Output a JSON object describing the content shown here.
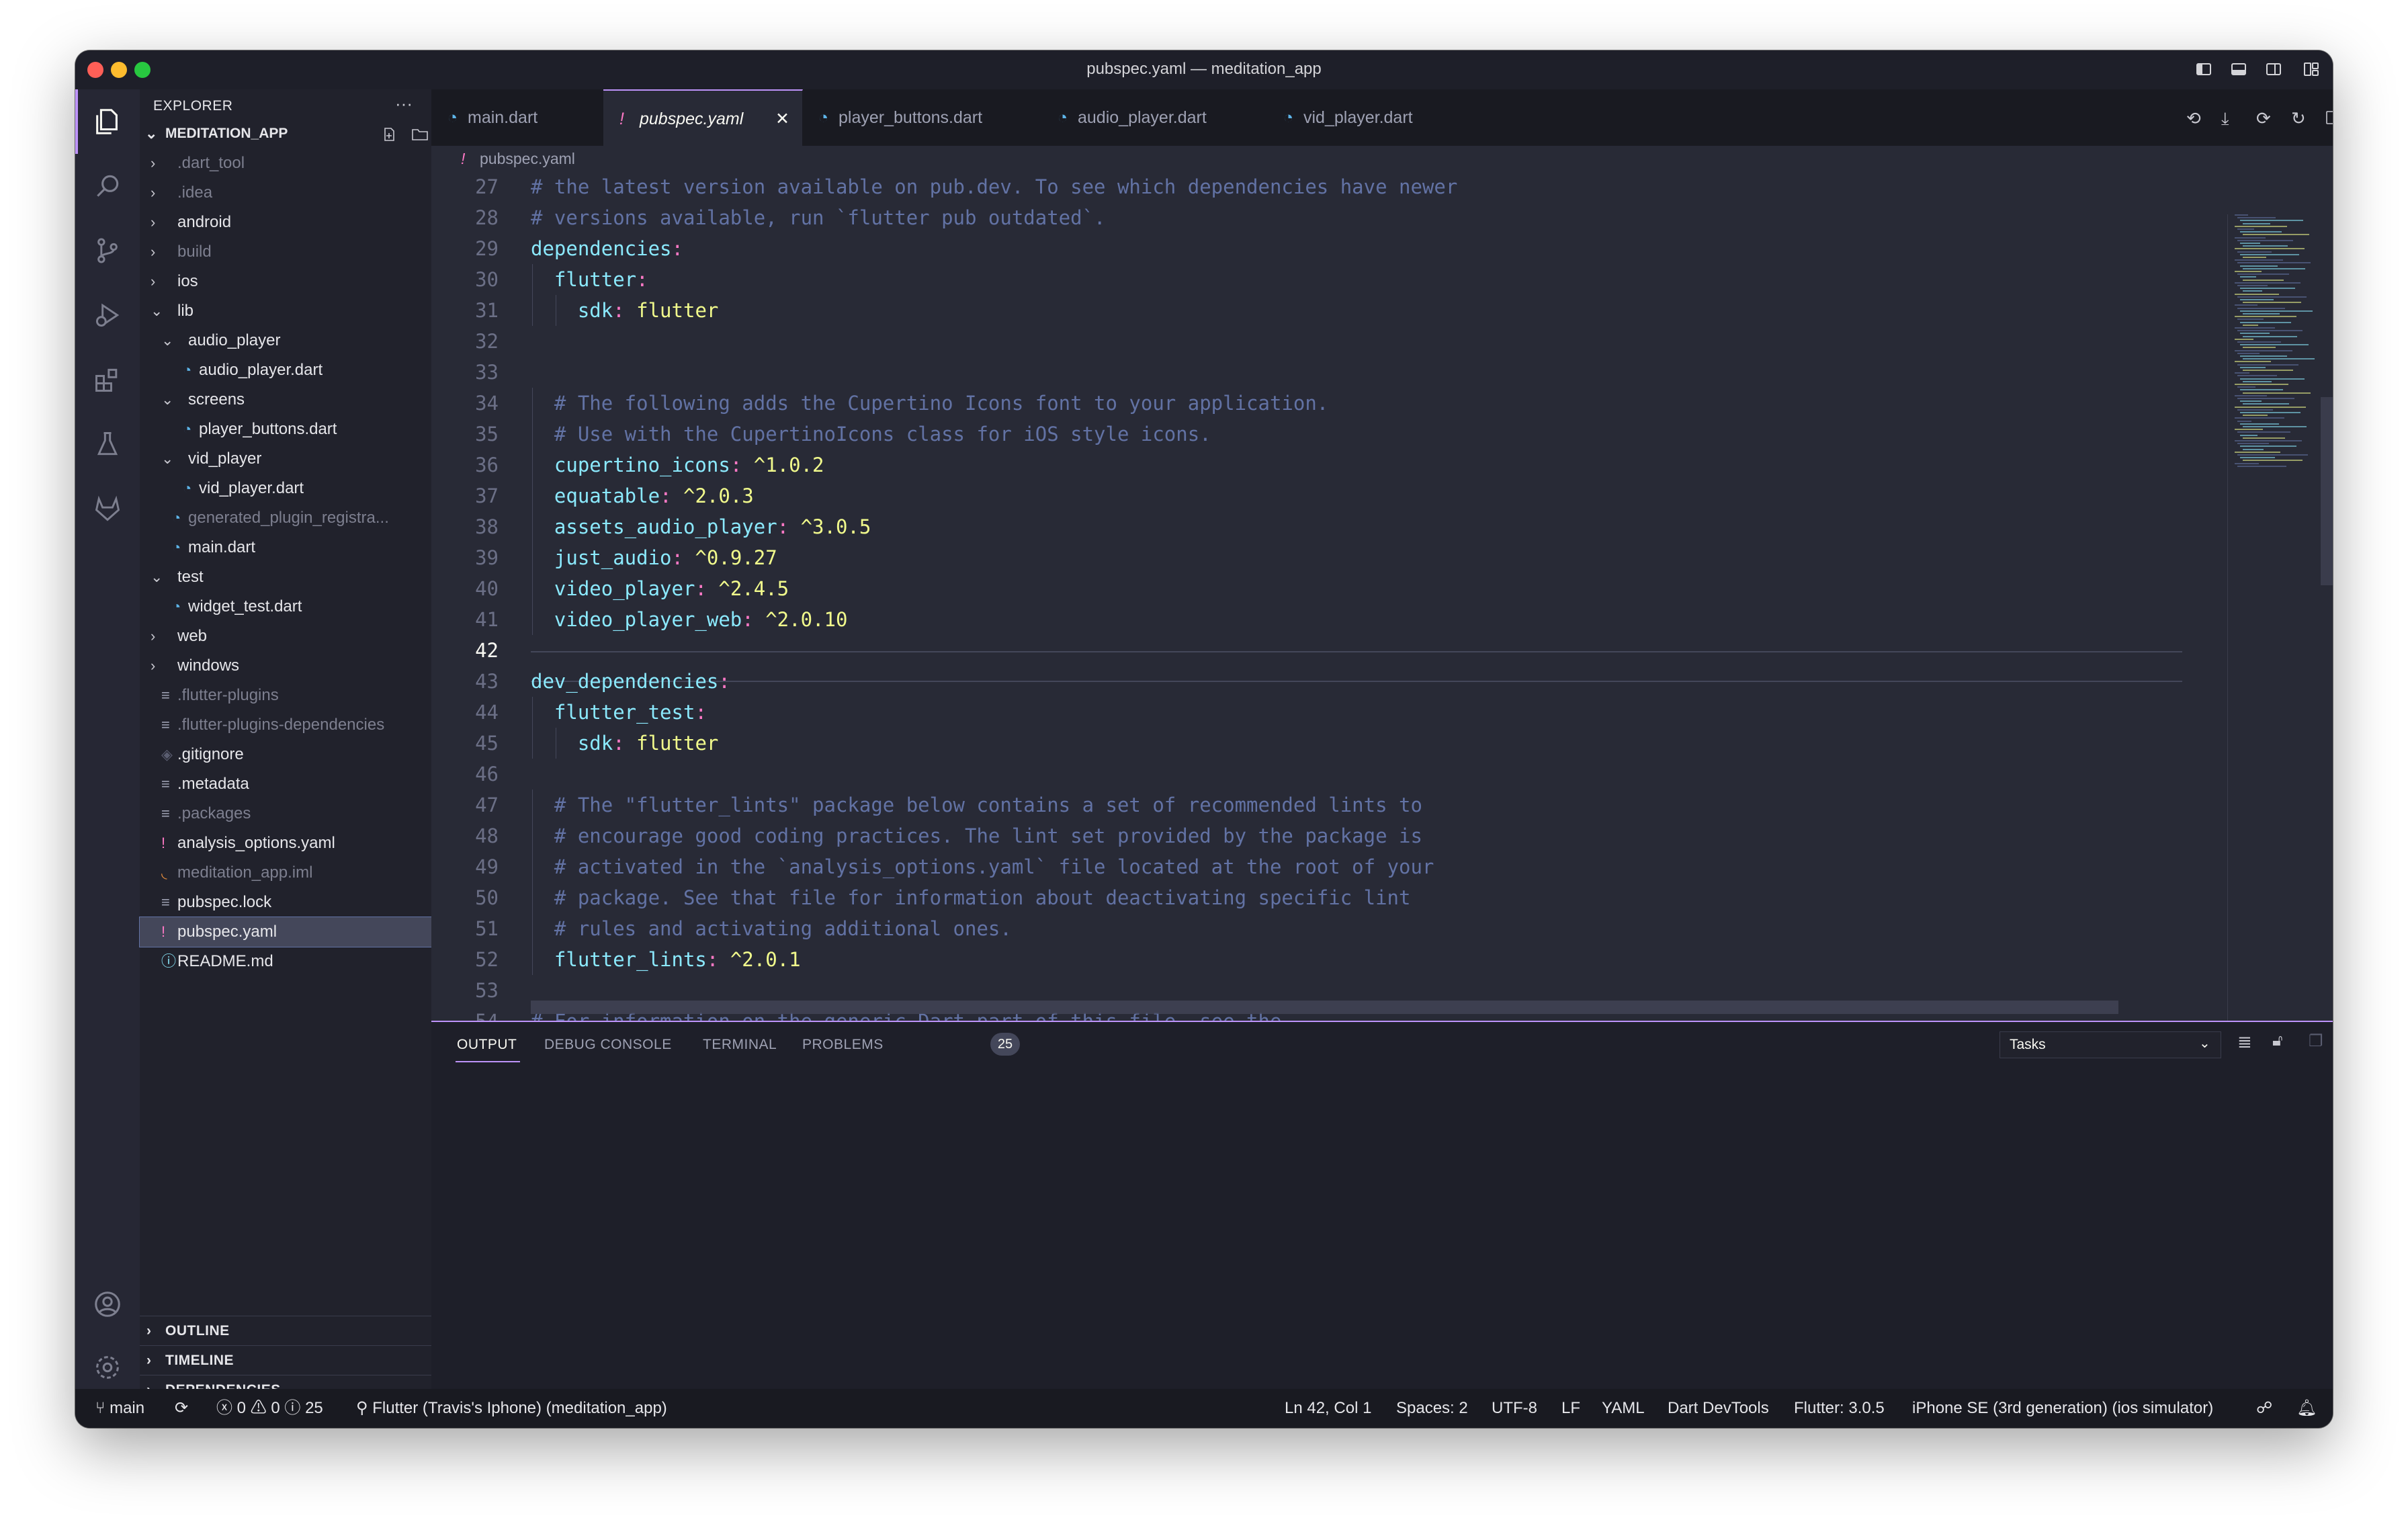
{
  "window": {
    "title": "pubspec.yaml — meditation_app"
  },
  "explorer": {
    "header": "EXPLORER",
    "root": "MEDITATION_APP",
    "items": [
      {
        "label": ".dart_tool",
        "depth": 0,
        "kind": "folder",
        "state": "collapsed",
        "dim": true
      },
      {
        "label": ".idea",
        "depth": 0,
        "kind": "folder",
        "state": "collapsed",
        "dim": true
      },
      {
        "label": "android",
        "depth": 0,
        "kind": "folder",
        "state": "collapsed",
        "dim": false
      },
      {
        "label": "build",
        "depth": 0,
        "kind": "folder",
        "state": "collapsed",
        "dim": true
      },
      {
        "label": "ios",
        "depth": 0,
        "kind": "folder",
        "state": "collapsed",
        "dim": false
      },
      {
        "label": "lib",
        "depth": 0,
        "kind": "folder",
        "state": "expanded",
        "dim": false
      },
      {
        "label": "audio_player",
        "depth": 1,
        "kind": "folder",
        "state": "expanded",
        "dim": false
      },
      {
        "label": "audio_player.dart",
        "depth": 2,
        "kind": "dart",
        "dim": false
      },
      {
        "label": "screens",
        "depth": 1,
        "kind": "folder",
        "state": "expanded",
        "dim": false
      },
      {
        "label": "player_buttons.dart",
        "depth": 2,
        "kind": "dart",
        "dim": false
      },
      {
        "label": "vid_player",
        "depth": 1,
        "kind": "folder",
        "state": "expanded",
        "dim": false
      },
      {
        "label": "vid_player.dart",
        "depth": 2,
        "kind": "dart",
        "dim": false
      },
      {
        "label": "generated_plugin_registra...",
        "depth": 1,
        "kind": "dart",
        "dim": true
      },
      {
        "label": "main.dart",
        "depth": 1,
        "kind": "dart",
        "dim": false
      },
      {
        "label": "test",
        "depth": 0,
        "kind": "folder",
        "state": "expanded",
        "dim": false
      },
      {
        "label": "widget_test.dart",
        "depth": 1,
        "kind": "dart",
        "dim": false
      },
      {
        "label": "web",
        "depth": 0,
        "kind": "folder",
        "state": "collapsed",
        "dim": false
      },
      {
        "label": "windows",
        "depth": 0,
        "kind": "folder",
        "state": "collapsed",
        "dim": false
      },
      {
        "label": ".flutter-plugins",
        "depth": 0,
        "kind": "lines",
        "dim": true
      },
      {
        "label": ".flutter-plugins-dependencies",
        "depth": 0,
        "kind": "lines",
        "dim": true
      },
      {
        "label": ".gitignore",
        "depth": 0,
        "kind": "git",
        "dim": false
      },
      {
        "label": ".metadata",
        "depth": 0,
        "kind": "lines",
        "dim": false
      },
      {
        "label": ".packages",
        "depth": 0,
        "kind": "lines",
        "dim": true
      },
      {
        "label": "analysis_options.yaml",
        "depth": 0,
        "kind": "yaml",
        "dim": false
      },
      {
        "label": "meditation_app.iml",
        "depth": 0,
        "kind": "rss",
        "dim": true
      },
      {
        "label": "pubspec.lock",
        "depth": 0,
        "kind": "lines",
        "dim": false
      },
      {
        "label": "pubspec.yaml",
        "depth": 0,
        "kind": "yaml",
        "dim": false,
        "selected": true
      },
      {
        "label": "README.md",
        "depth": 0,
        "kind": "info",
        "dim": false
      }
    ],
    "sections": [
      "OUTLINE",
      "TIMELINE",
      "DEPENDENCIES"
    ]
  },
  "tabs": [
    {
      "label": "main.dart",
      "icon": "dart-icon",
      "active": false
    },
    {
      "label": "pubspec.yaml",
      "icon": "yaml-icon",
      "active": true
    },
    {
      "label": "player_buttons.dart",
      "icon": "dart-icon",
      "active": false
    },
    {
      "label": "audio_player.dart",
      "icon": "dart-icon",
      "active": false
    },
    {
      "label": "vid_player.dart",
      "icon": "dart-icon",
      "active": false
    }
  ],
  "breadcrumb": "pubspec.yaml",
  "editor": {
    "current_line": 42,
    "lines": [
      {
        "n": "27",
        "parts": [
          [
            "# the latest version available on pub.dev. To see which dependencies have newer",
            "cmt"
          ]
        ]
      },
      {
        "n": "28",
        "parts": [
          [
            "# versions available, run `flutter pub outdated`.",
            "cmt"
          ]
        ]
      },
      {
        "n": "29",
        "parts": [
          [
            "dependencies",
            "key"
          ],
          [
            ":",
            "pun"
          ]
        ]
      },
      {
        "n": "30",
        "parts": [
          [
            "  flutter",
            "key"
          ],
          [
            ":",
            "pun"
          ]
        ]
      },
      {
        "n": "31",
        "parts": [
          [
            "    sdk",
            "key"
          ],
          [
            ": ",
            "pun"
          ],
          [
            "flutter",
            "str"
          ]
        ]
      },
      {
        "n": "32",
        "parts": []
      },
      {
        "n": "33",
        "parts": []
      },
      {
        "n": "34",
        "parts": [
          [
            "  # The following adds the Cupertino Icons font to your application.",
            "cmt"
          ]
        ]
      },
      {
        "n": "35",
        "parts": [
          [
            "  # Use with the CupertinoIcons class for iOS style icons.",
            "cmt"
          ]
        ]
      },
      {
        "n": "36",
        "parts": [
          [
            "  cupertino_icons",
            "key"
          ],
          [
            ": ",
            "pun"
          ],
          [
            "^1.0.2",
            "str"
          ]
        ]
      },
      {
        "n": "37",
        "parts": [
          [
            "  equatable",
            "key"
          ],
          [
            ": ",
            "pun"
          ],
          [
            "^2.0.3",
            "str"
          ]
        ]
      },
      {
        "n": "38",
        "parts": [
          [
            "  assets_audio_player",
            "key"
          ],
          [
            ": ",
            "pun"
          ],
          [
            "^3.0.5",
            "str"
          ]
        ]
      },
      {
        "n": "39",
        "parts": [
          [
            "  just_audio",
            "key"
          ],
          [
            ": ",
            "pun"
          ],
          [
            "^0.9.27",
            "str"
          ]
        ]
      },
      {
        "n": "40",
        "parts": [
          [
            "  video_player",
            "key"
          ],
          [
            ": ",
            "pun"
          ],
          [
            "^2.4.5",
            "str"
          ]
        ]
      },
      {
        "n": "41",
        "parts": [
          [
            "  video_player_web",
            "key"
          ],
          [
            ": ",
            "pun"
          ],
          [
            "^2.0.10",
            "str"
          ]
        ]
      },
      {
        "n": "42",
        "parts": []
      },
      {
        "n": "43",
        "parts": [
          [
            "dev_dependencies",
            "key"
          ],
          [
            ":",
            "pun"
          ]
        ]
      },
      {
        "n": "44",
        "parts": [
          [
            "  flutter_test",
            "key"
          ],
          [
            ":",
            "pun"
          ]
        ]
      },
      {
        "n": "45",
        "parts": [
          [
            "    sdk",
            "key"
          ],
          [
            ": ",
            "pun"
          ],
          [
            "flutter",
            "str"
          ]
        ]
      },
      {
        "n": "46",
        "parts": []
      },
      {
        "n": "47",
        "parts": [
          [
            "  # The \"flutter_lints\" package below contains a set of recommended lints to",
            "cmt"
          ]
        ]
      },
      {
        "n": "48",
        "parts": [
          [
            "  # encourage good coding practices. The lint set provided by the package is",
            "cmt"
          ]
        ]
      },
      {
        "n": "49",
        "parts": [
          [
            "  # activated in the `analysis_options.yaml` file located at the root of your",
            "cmt"
          ]
        ]
      },
      {
        "n": "50",
        "parts": [
          [
            "  # package. See that file for information about deactivating specific lint",
            "cmt"
          ]
        ]
      },
      {
        "n": "51",
        "parts": [
          [
            "  # rules and activating additional ones.",
            "cmt"
          ]
        ]
      },
      {
        "n": "52",
        "parts": [
          [
            "  flutter_lints",
            "key"
          ],
          [
            ": ",
            "pun"
          ],
          [
            "^2.0.1",
            "str"
          ]
        ]
      },
      {
        "n": "53",
        "parts": []
      },
      {
        "n": "54",
        "parts": [
          [
            "# For information on the generic Dart part of this file, see the",
            "cmt"
          ]
        ]
      }
    ]
  },
  "panel": {
    "tabs": [
      "OUTPUT",
      "DEBUG CONSOLE",
      "TERMINAL",
      "PROBLEMS"
    ],
    "active_tab": "OUTPUT",
    "problems_count": "25",
    "select_value": "Tasks"
  },
  "status": {
    "branch": "main",
    "errors": "0",
    "warnings": "0",
    "infos": "25",
    "device_target": "Flutter (Travis's Iphone) (meditation_app)",
    "position": "Ln 42, Col 1",
    "spaces": "Spaces: 2",
    "encoding": "UTF-8",
    "eol": "LF",
    "language": "YAML",
    "devtools": "Dart DevTools",
    "flutter_version": "Flutter: 3.0.5",
    "device": "iPhone SE (3rd generation) (ios simulator)"
  },
  "colors": {
    "accent": "#bd93f9",
    "dart": "#5db4e8",
    "yaml": "#ff79c6",
    "rss": "#e08a3c"
  }
}
